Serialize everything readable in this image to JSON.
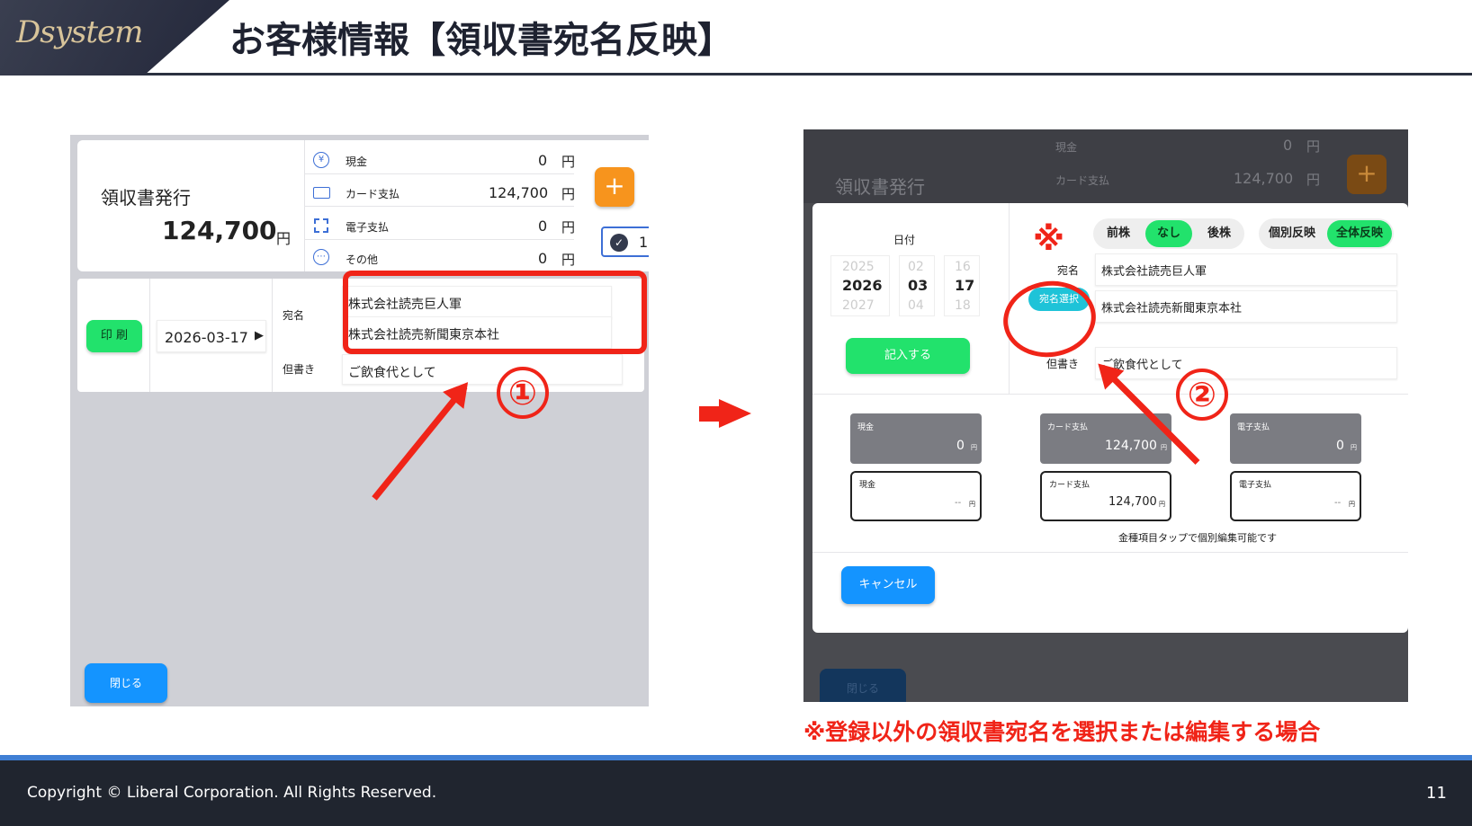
{
  "header": {
    "logo_text": "Dsystem",
    "title": "お客様情報【領収書宛名反映】"
  },
  "left": {
    "receipt_title": "領収書発行",
    "total_amount": "124,700",
    "yen": "円",
    "payments": [
      {
        "icon": "yen-icon",
        "label": "現金",
        "amount": "0",
        "unit": "円"
      },
      {
        "icon": "card-icon",
        "label": "カード支払",
        "amount": "124,700",
        "unit": "円"
      },
      {
        "icon": "qr-icon",
        "label": "電子支払",
        "amount": "0",
        "unit": "円"
      },
      {
        "icon": "more-icon",
        "label": "その他",
        "amount": "0",
        "unit": "円"
      }
    ],
    "plus_label": "+",
    "check_label": "1",
    "print_button": "印 刷",
    "date": "2026-03-17",
    "addressee_label": "宛名",
    "addressees": [
      "株式会社読売巨人軍",
      "株式会社読売新聞東京本社"
    ],
    "note_label": "但書き",
    "note_value": "ご飲食代として",
    "close_button": "閉じる",
    "step": "①"
  },
  "right": {
    "bg": {
      "receipt_title": "領収書発行",
      "payments": [
        {
          "label": "現金",
          "amount": "0",
          "unit": "円"
        },
        {
          "label": "カード支払",
          "amount": "124,700",
          "unit": "円"
        }
      ],
      "plus_label": "+",
      "close_button": "閉じる"
    },
    "modal": {
      "date_label": "日付",
      "year": {
        "prev": "2025",
        "cur": "2026",
        "next": "2027"
      },
      "month": {
        "prev": "02",
        "cur": "03",
        "next": "04"
      },
      "day": {
        "prev": "16",
        "cur": "17",
        "next": "18"
      },
      "enter_button": "記入する",
      "toggles": [
        {
          "label": "前株",
          "active": false
        },
        {
          "label": "なし",
          "active": true
        },
        {
          "label": "後株",
          "active": false
        }
      ],
      "toggles2": [
        {
          "label": "個別反映",
          "active": false
        },
        {
          "label": "全体反映",
          "active": true
        }
      ],
      "asterisk": "※",
      "addressee_label": "宛名",
      "addressee_select_button": "宛名選択",
      "addressees": [
        "株式会社読売巨人軍",
        "株式会社読売新聞東京本社"
      ],
      "note_label": "但書き",
      "note_value": "ご飲食代として",
      "amounts_grey": [
        {
          "label": "現金",
          "amount": "0",
          "unit": "円"
        },
        {
          "label": "カード支払",
          "amount": "124,700",
          "unit": "円"
        },
        {
          "label": "電子支払",
          "amount": "0",
          "unit": "円"
        }
      ],
      "amounts_white": [
        {
          "label": "現金",
          "amount": "--",
          "unit": "円"
        },
        {
          "label": "カード支払",
          "amount": "124,700",
          "unit": "円"
        },
        {
          "label": "電子支払",
          "amount": "--",
          "unit": "円"
        }
      ],
      "hint": "金種項目タップで個別編集可能です",
      "cancel_button": "キャンセル"
    },
    "step": "②",
    "note_caption": "※登録以外の領収書宛名を選択または編集する場合"
  },
  "colors": {
    "accent_red": "#f02418",
    "green": "#22e26c",
    "blue": "#1494ff",
    "orange": "#f7941d"
  },
  "footer": {
    "copyright": "Copyright ©  Liberal Corporation. All Rights Reserved.",
    "page_number": "11"
  }
}
